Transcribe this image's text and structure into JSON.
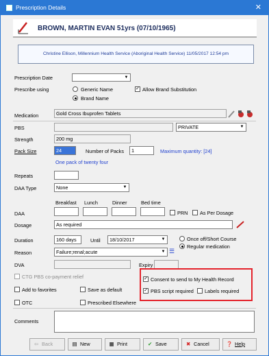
{
  "window": {
    "title": "Prescription Details",
    "close_glyph": "✕"
  },
  "patient": {
    "name": "BROWN, MARTIN EVAN 51yrs (07/10/1965)"
  },
  "prescriber": {
    "text": "Christine Ellison, Millennium Health Service (Aboriginal Health Service) 11/05/2017 12:54 pm"
  },
  "form": {
    "prescription_date": {
      "label": "Prescription Date",
      "value": ""
    },
    "prescribe_using": {
      "label": "Prescribe using",
      "generic": "Generic Name",
      "brand": "Brand Name",
      "selected": "brand"
    },
    "allow_brand_substitution": {
      "label": "Allow Brand Substitution",
      "checked": true
    },
    "medication": {
      "label": "Medication",
      "value": "Gold Cross Ibuprofen Tablets"
    },
    "pbs": {
      "label": "PBS",
      "value": "",
      "type_value": "PRIVATE"
    },
    "strength": {
      "label": "Strength",
      "value": "200 mg"
    },
    "pack_size": {
      "label": "Pack Size",
      "value": "24"
    },
    "number_of_packs": {
      "label": "Number of Packs",
      "value": "1"
    },
    "max_quantity": "Maximum quantity: [24]",
    "pack_note": "One pack of twenty four",
    "repeats": {
      "label": "Repeats",
      "value": ""
    },
    "daa_type": {
      "label": "DAA Type",
      "value": "None"
    },
    "daa_times": {
      "breakfast": "Breakfast",
      "lunch": "Lunch",
      "dinner": "Dinner",
      "bed_time": "Bed time"
    },
    "daa": {
      "label": "DAA",
      "prn": "PRN",
      "as_per_dosage": "As Per Dosage"
    },
    "dosage": {
      "label": "Dosage",
      "value": "As required"
    },
    "duration": {
      "label": "Duration",
      "value": "160 days",
      "until_label": "Until",
      "until_value": "18/10/2017"
    },
    "course": {
      "once_off": "Once off/Short Course",
      "regular": "Regular medication",
      "selected": "regular"
    },
    "reason": {
      "label": "Reason",
      "value": "Failure;renal;acute"
    },
    "dva": {
      "label": "DVA",
      "value": "",
      "expiry_label": "Expiry",
      "expiry_value": ""
    },
    "ctg": {
      "label": "CTG PBS co-payment relief"
    },
    "add_to_favorites": {
      "label": "Add to favorites"
    },
    "save_as_default": {
      "label": "Save as default"
    },
    "otc": {
      "label": "OTC"
    },
    "prescribed_elsewhere": {
      "label": "Prescribed Elsewhere"
    },
    "consent": {
      "label": "Consent to send to My Health Record",
      "checked": true
    },
    "pbs_script_required": {
      "label": "PBS script required",
      "checked": true
    },
    "labels_required": {
      "label": "Labels required",
      "checked": false
    },
    "comments": {
      "label": "Comments",
      "value": ""
    }
  },
  "buttons": {
    "back": "Back",
    "new": "New",
    "print": "Print",
    "save": "Save",
    "cancel": "Cancel",
    "help": "Help"
  },
  "colors": {
    "titlebar": "#2b78d4",
    "highlight": "#e4222b",
    "info_text": "#1f3fcf"
  }
}
